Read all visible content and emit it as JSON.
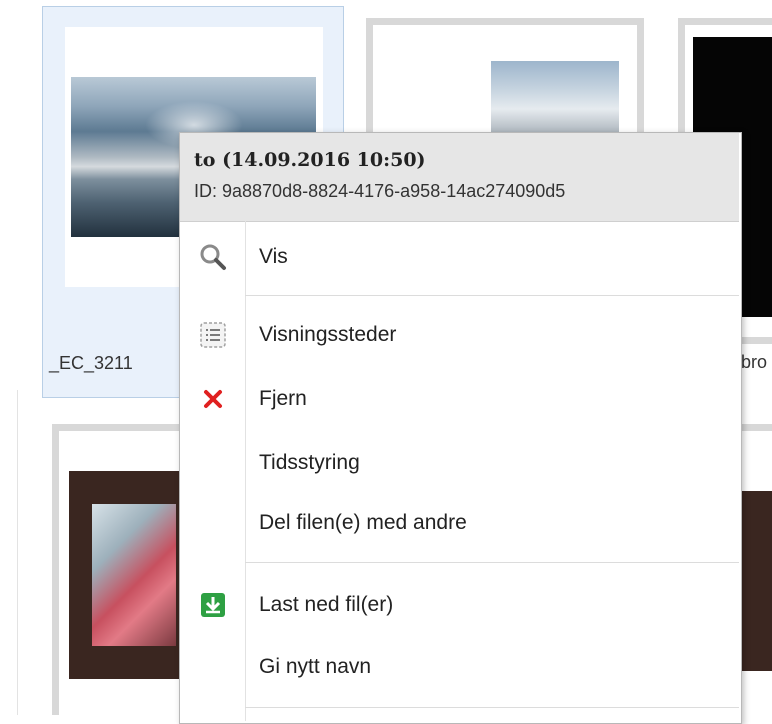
{
  "gallery": {
    "tiles": [
      {
        "label": "_EC_3211"
      },
      {
        "label": ""
      },
      {
        "label": "bro"
      }
    ]
  },
  "context_menu": {
    "title": "to (14.09.2016 10:50)",
    "id_line": "ID: 9a8870d8-8824-4176-a958-14ac274090d5",
    "items": [
      {
        "label": "Vis",
        "icon": "magnifier-icon"
      },
      {
        "label": "Visningssteder",
        "icon": "list-icon"
      },
      {
        "label": "Fjern",
        "icon": "red-x-icon"
      },
      {
        "label": "Tidsstyring",
        "icon": ""
      },
      {
        "label": "Del filen(e) med andre",
        "icon": ""
      },
      {
        "label": "Last ned fil(er)",
        "icon": "green-download-icon"
      },
      {
        "label": "Gi nytt navn",
        "icon": ""
      }
    ]
  },
  "colors": {
    "selection_border": "#b9cfe6",
    "remove_icon": "#e02020",
    "download_icon": "#2ea043"
  }
}
